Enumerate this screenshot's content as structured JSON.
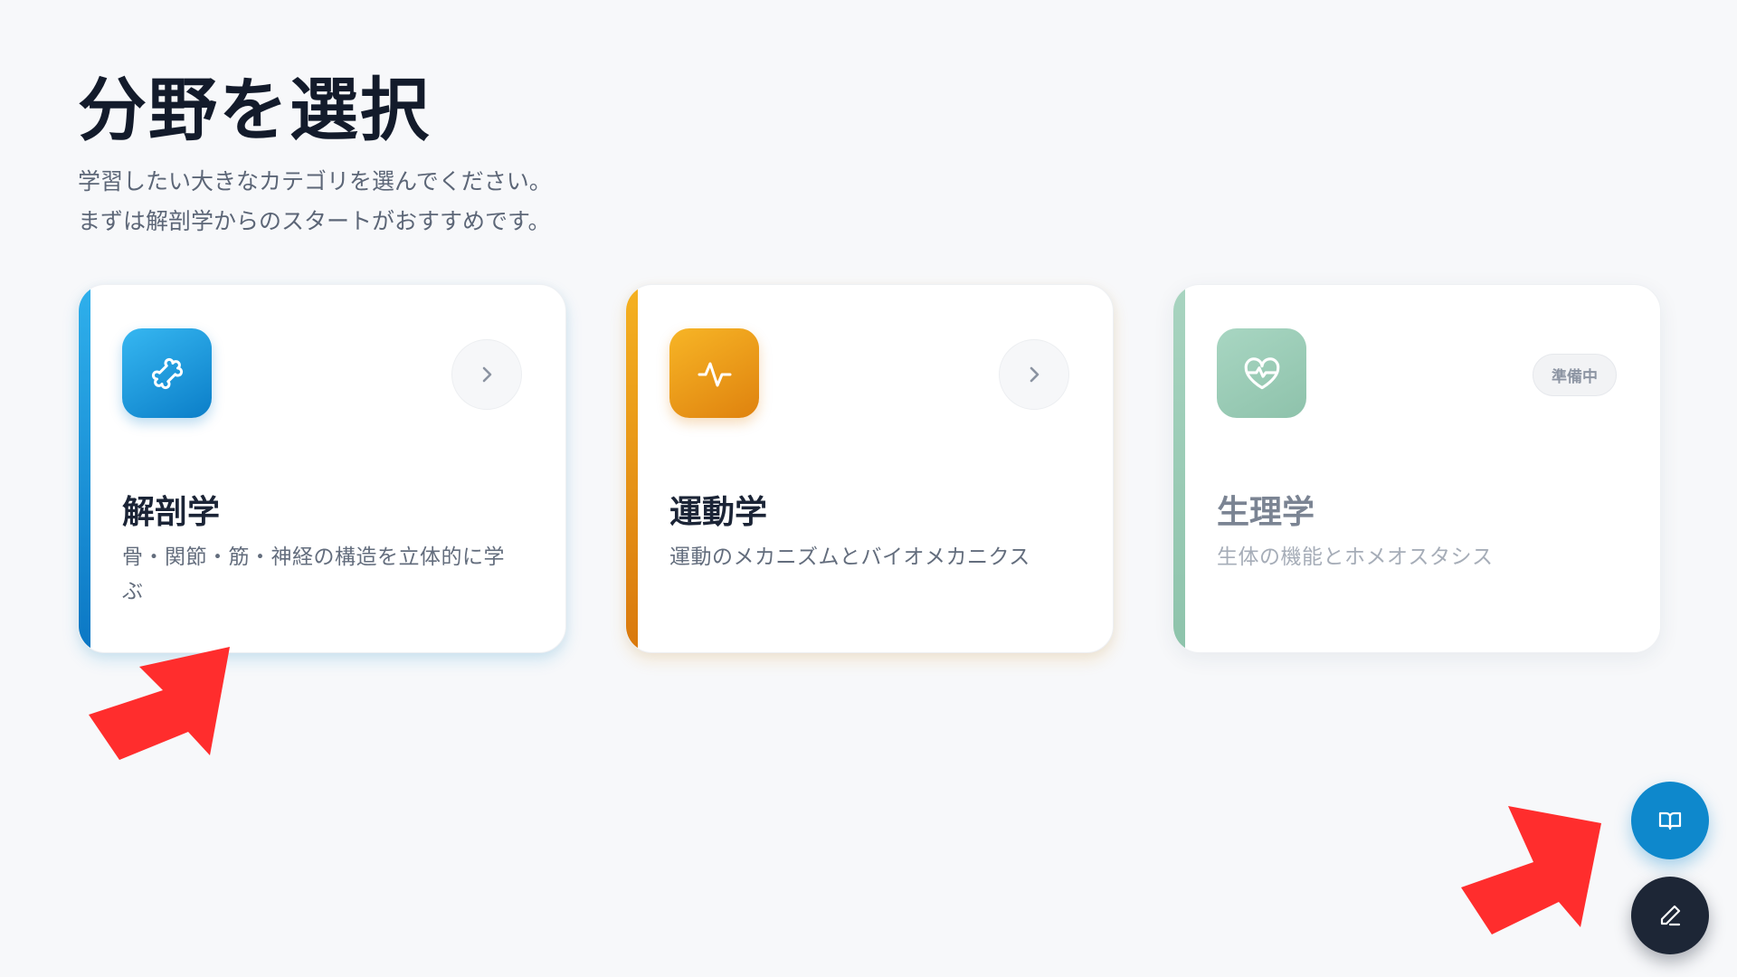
{
  "header": {
    "title": "分野を選択",
    "subtitle_line1": "学習したい大きなカテゴリを選んでください。",
    "subtitle_line2": "まずは解剖学からのスタートがおすすめです。"
  },
  "cards": [
    {
      "id": "anatomy",
      "title": "解剖学",
      "description": "骨・関節・筋・神経の構造を立体的に学ぶ",
      "icon": "bone-icon",
      "accent_color": "#0b8ad6",
      "status": "available"
    },
    {
      "id": "kinesiology",
      "title": "運動学",
      "description": "運動のメカニズムとバイオメカニクス",
      "icon": "activity-pulse-icon",
      "accent_color": "#e8900f",
      "status": "available"
    },
    {
      "id": "physiology",
      "title": "生理学",
      "description": "生体の機能とホメオスタシス",
      "icon": "heart-pulse-icon",
      "accent_color": "#97c9b3",
      "status": "coming_soon",
      "badge": "準備中"
    }
  ],
  "fabs": {
    "book_icon": "open-book-icon",
    "edit_icon": "pencil-icon"
  },
  "colors": {
    "background": "#f7f8fa",
    "primary": "#0e88cc",
    "dark": "#1d2636",
    "annotation_arrow": "#ff2d2d"
  }
}
